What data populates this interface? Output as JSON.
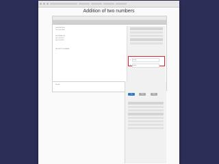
{
  "slide": {
    "title": "Addition of two numbers"
  },
  "left_panel": {
    "sections": [
      {
        "header": "DESCRIPTION",
        "line": "Two input fields"
      },
      {
        "header": "INFORMATION",
        "lines": [
          "input:number1",
          "input:number2"
        ]
      },
      {
        "header": "SECURITY SCHEMES",
        "lines": [
          "...",
          "..."
        ]
      }
    ]
  },
  "form": {
    "a_label": "a",
    "a_value": "",
    "a_hint": "string",
    "b_label": "b",
    "b_value": "",
    "b_hint": "string"
  },
  "buttons": {
    "try": "Try",
    "clear": "Clear",
    "help": "Help"
  },
  "below": {
    "text": "Results"
  }
}
